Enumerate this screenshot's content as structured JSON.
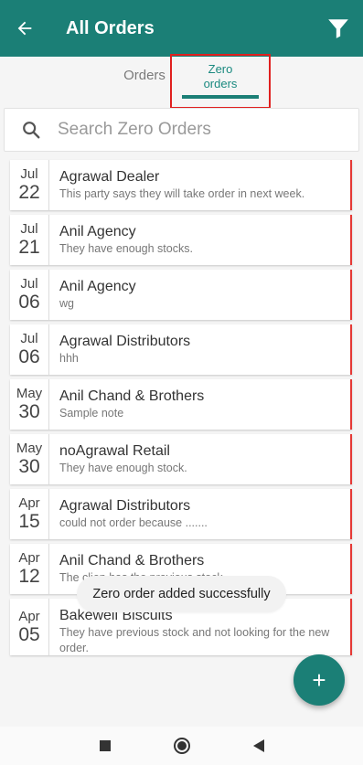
{
  "header": {
    "title": "All Orders",
    "back_icon": "arrow-left-icon",
    "filter_icon": "filter-icon"
  },
  "tabs": [
    {
      "label": "Orders"
    },
    {
      "label_line1": "Zero",
      "label_line2": "orders",
      "selected": true
    }
  ],
  "search": {
    "placeholder": "Search Zero Orders",
    "value": ""
  },
  "orders": [
    {
      "month": "Jul",
      "day": "22",
      "party": "Agrawal Dealer",
      "note": "This party says they will take order in next week."
    },
    {
      "month": "Jul",
      "day": "21",
      "party": "Anil Agency",
      "note": "They have enough stocks."
    },
    {
      "month": "Jul",
      "day": "06",
      "party": "Anil Agency",
      "note": "wg"
    },
    {
      "month": "Jul",
      "day": "06",
      "party": "Agrawal Distributors",
      "note": "hhh"
    },
    {
      "month": "May",
      "day": "30",
      "party": "Anil Chand & Brothers",
      "note": "Sample note"
    },
    {
      "month": "May",
      "day": "30",
      "party": "noAgrawal Retail",
      "note": "They have enough stock."
    },
    {
      "month": "Apr",
      "day": "15",
      "party": "Agrawal Distributors",
      "note": "could not order because ......."
    },
    {
      "month": "Apr",
      "day": "12",
      "party": "Anil Chand & Brothers",
      "note": "The clien has the previous stock."
    },
    {
      "month": "Apr",
      "day": "05",
      "party": "Bakewell Biscuits",
      "note": "They have previous stock and not looking for the new order."
    }
  ],
  "toast": {
    "message": "Zero order added successfully"
  },
  "fab": {
    "label": "+"
  },
  "colors": {
    "primary": "#1b7f76",
    "accent_border": "#e53935"
  }
}
